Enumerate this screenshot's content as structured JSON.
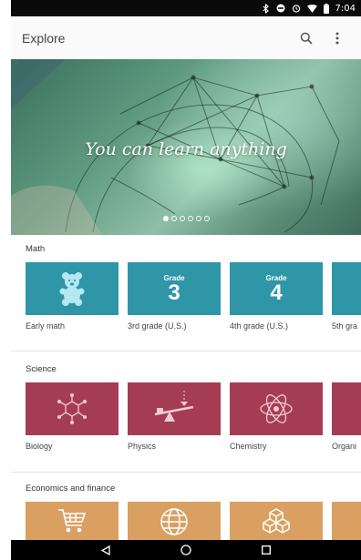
{
  "status_bar": {
    "time": "7:04",
    "icons": [
      "bluetooth-icon",
      "do-not-disturb-icon",
      "alarm-icon",
      "wifi-icon",
      "battery-icon"
    ]
  },
  "app_bar": {
    "title": "Explore",
    "icons": [
      "search-icon",
      "more-vert-icon"
    ]
  },
  "hero": {
    "caption": "You can learn anything",
    "slide_count": 6,
    "active_slide": 1
  },
  "sections": [
    {
      "title": "Math",
      "color": "#2f96a8",
      "tiles": [
        {
          "label": "Early math",
          "icon": "teddy-bear-icon"
        },
        {
          "label": "3rd grade (U.S.)",
          "grade_word": "Grade",
          "grade_number": "3"
        },
        {
          "label": "4th grade (U.S.)",
          "grade_word": "Grade",
          "grade_number": "4"
        },
        {
          "label": "5th gra"
        }
      ]
    },
    {
      "title": "Science",
      "color": "#a43d54",
      "tiles": [
        {
          "label": "Biology",
          "icon": "molecule-icon"
        },
        {
          "label": "Physics",
          "icon": "lever-icon"
        },
        {
          "label": "Chemistry",
          "icon": "atom-icon"
        },
        {
          "label": "Organi"
        }
      ]
    },
    {
      "title": "Economics and finance",
      "color": "#d9a062",
      "tiles": [
        {
          "label": "",
          "icon": "shopping-cart-icon"
        },
        {
          "label": "",
          "icon": "globe-icon"
        },
        {
          "label": "",
          "icon": "cubes-icon"
        },
        {
          "label": ""
        }
      ]
    }
  ],
  "nav_bar": {
    "icons": [
      "back-icon",
      "home-icon",
      "recents-icon"
    ]
  }
}
